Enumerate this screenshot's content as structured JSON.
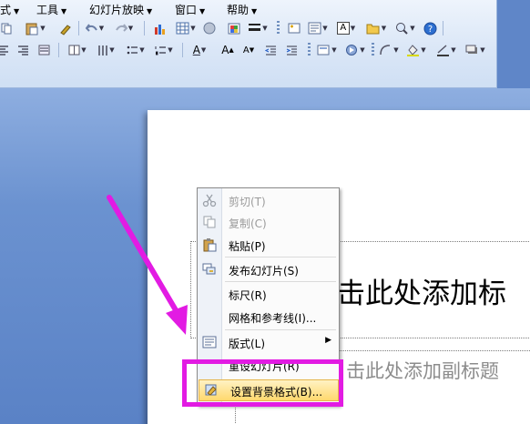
{
  "menubar": {
    "items": [
      {
        "label": "式",
        "has_caret": true
      },
      {
        "label": "工具",
        "has_caret": true
      },
      {
        "label": "幻灯片放映",
        "has_caret": true
      },
      {
        "label": "窗口",
        "has_caret": true
      },
      {
        "label": "帮助",
        "has_caret": true
      }
    ]
  },
  "toolbar": {
    "text_box_glyph": "A",
    "font_size_increase": "A",
    "font_size_decrease": "A",
    "font_color": "A"
  },
  "slide": {
    "title_placeholder": "击此处添加标",
    "subtitle_placeholder": "击此处添加副标题"
  },
  "context_menu": {
    "items": [
      {
        "label": "剪切(T)",
        "icon": "scissors-icon",
        "enabled": false
      },
      {
        "label": "复制(C)",
        "icon": "copy-icon",
        "enabled": false
      },
      {
        "label": "粘贴(P)",
        "icon": "paste-icon",
        "enabled": true
      },
      {
        "label": "发布幻灯片(S)",
        "icon": "publish-slides-icon",
        "enabled": true
      },
      {
        "label": "标尺(R)",
        "icon": "",
        "enabled": true
      },
      {
        "label": "网格和参考线(I)...",
        "icon": "",
        "enabled": true
      },
      {
        "label": "版式(L)",
        "icon": "layout-icon",
        "enabled": true,
        "has_submenu": true
      },
      {
        "label": "重设幻灯片(R)",
        "icon": "",
        "enabled": true
      },
      {
        "label": "设置背景格式(B)...",
        "icon": "format-background-icon",
        "enabled": true,
        "highlighted": true
      }
    ]
  },
  "colors": {
    "annotation": "#e21be3",
    "highlight": "#ffd86d",
    "workspace": "#6b92d0"
  }
}
